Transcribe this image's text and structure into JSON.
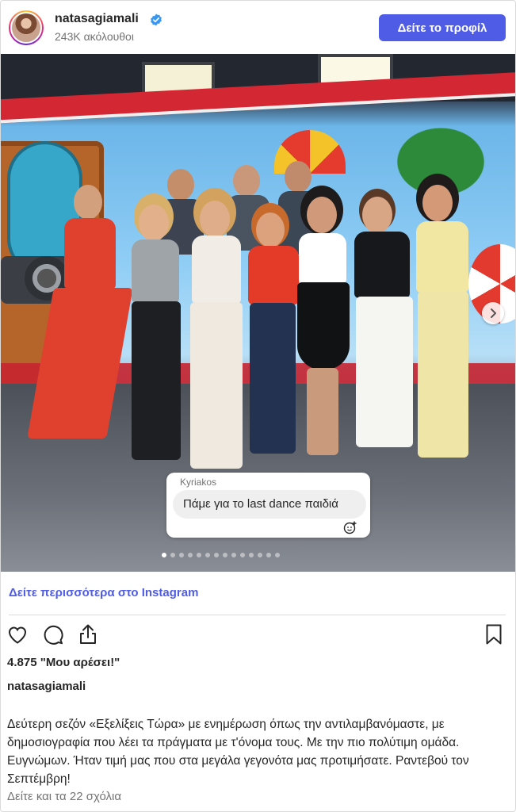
{
  "header": {
    "username": "natasagiamali",
    "followers": "243K ακόλουθοι",
    "profile_button": "Δείτε το προφίλ"
  },
  "photo": {
    "overlay_comment": {
      "author": "Kyriakos",
      "text": "Πάμε για το last dance παιδιά"
    },
    "carousel": {
      "total": 14,
      "active_index": 0
    }
  },
  "more_link": "Δείτε περισσότερα στο Instagram",
  "likes": "4.875 \"Μου αρέσει!\"",
  "caption": {
    "username": "natasagiamali",
    "text": "Δεύτερη σεζόν «Εξελίξεις Τώρα» με ενημέρωση όπως την αντιλαμβανόμαστε, με δημοσιογραφία που λέει τα πράγματα με τ'όνομα τους. Με την πιο πολύτιμη ομάδα. Ευγνώμων. Ήταν τιμή μας που στα μεγάλα γεγονότα μας προτιμήσατε. Ραντεβού τον Σεπτέμβρη!"
  },
  "comments_link": "Δείτε και τα 22 σχόλια",
  "icons": {
    "verified": "verified-badge-icon",
    "like": "heart-icon",
    "comment": "comment-icon",
    "share": "share-icon",
    "save": "bookmark-icon",
    "next": "chevron-right-icon",
    "emoji": "emoji-icon"
  },
  "colors": {
    "accent": "#4f5ce6",
    "verified": "#3897f0"
  }
}
